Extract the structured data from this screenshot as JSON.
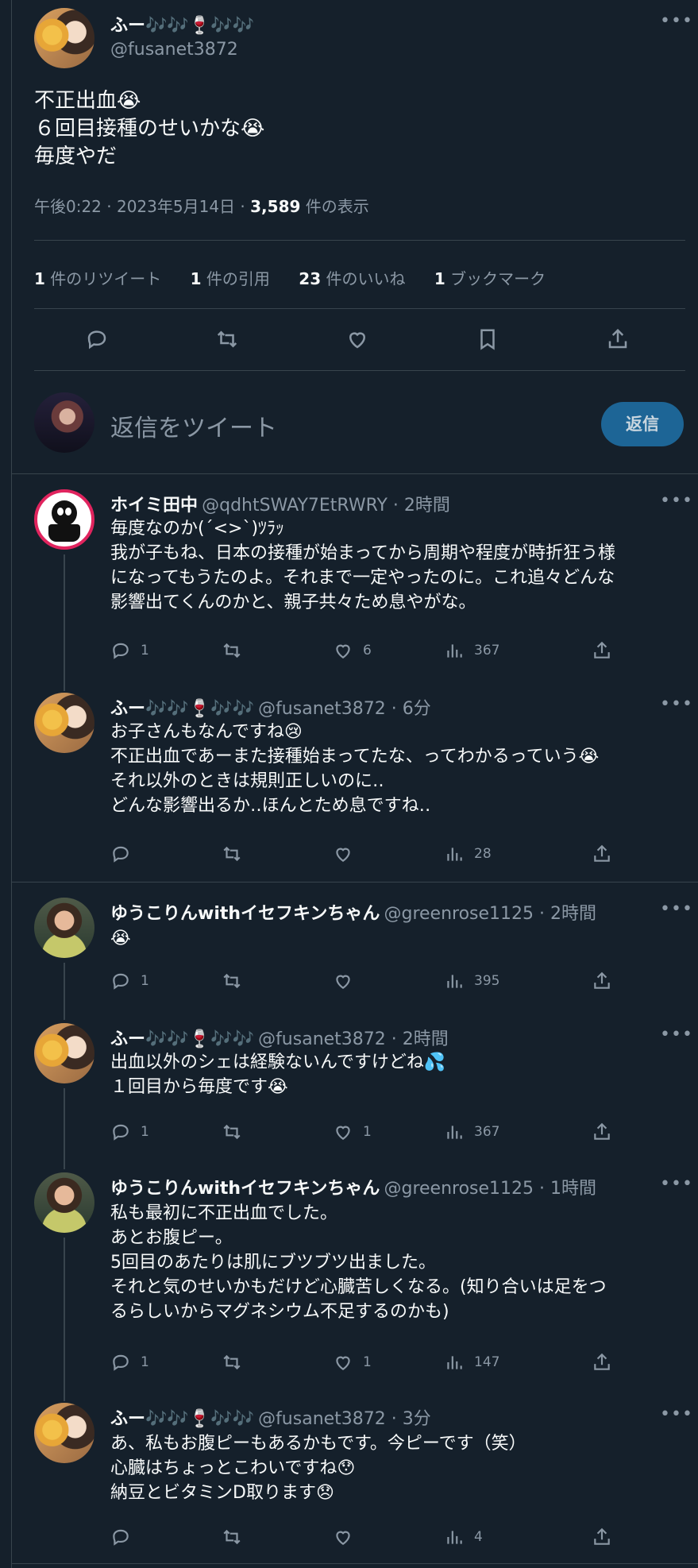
{
  "main_tweet": {
    "name": "ふー🎶🎶🍷🎶🎶",
    "handle": "@fusanet3872",
    "text": "不正出血😭\n６回目接種のせいかな😭\n毎度やだ",
    "timestamp": "午後0:22 · 2023年5月14日 · ",
    "views_count": "3,589",
    "views_label": " 件の表示",
    "stats": [
      {
        "count": "1",
        "label": " 件のリツイート"
      },
      {
        "count": "1",
        "label": " 件の引用"
      },
      {
        "count": "23",
        "label": " 件のいいね"
      },
      {
        "count": "1",
        "label": " ブックマーク"
      }
    ]
  },
  "reply_box": {
    "placeholder": "返信をツイート",
    "button": "返信"
  },
  "replies": [
    {
      "name": "ホイミ田中",
      "handle": "@qdhtSWAY7EtRWRY · 2時間",
      "text": "毎度なのか(´<>`)ﾂﾗｯ\n我が子もね、日本の接種が始まってから周期や程度が時折狂う様\nになってもうたのよ。それまで一定やったのに。これ追々どんな\n影響出てくんのかと、親子共々ため息やがな。",
      "reply": "1",
      "retweet": "",
      "like": "6",
      "views": "367"
    },
    {
      "name": "ふー🎶🎶🍷🎶🎶",
      "handle": "@fusanet3872 · 6分",
      "text": "お子さんもなんですね😢\n不正出血であーまた接種始まってたな、ってわかるっていう😭\nそれ以外のときは規則正しいのに‥\nどんな影響出るか‥ほんとため息ですね‥",
      "reply": "",
      "retweet": "",
      "like": "",
      "views": "28"
    },
    {
      "name": "ゆうこりんwithイセフキンちゃん",
      "handle": "@greenrose1125 · 2時間",
      "text": "😭",
      "reply": "1",
      "retweet": "",
      "like": "",
      "views": "395"
    },
    {
      "name": "ふー🎶🎶🍷🎶🎶",
      "handle": "@fusanet3872 · 2時間",
      "text": "出血以外のシェは経験ないんですけどね💦\n１回目から毎度です😭",
      "reply": "1",
      "retweet": "",
      "like": "1",
      "views": "367"
    },
    {
      "name": "ゆうこりんwithイセフキンちゃん",
      "handle": "@greenrose1125 · 1時間",
      "text": "私も最初に不正出血でした。\nあとお腹ピー。\n5回目のあたりは肌にブツブツ出ました。\nそれと気のせいかもだけど心臓苦しくなる。(知り合いは足をつ\nるらしいからマグネシウム不足するのかも)",
      "reply": "1",
      "retweet": "",
      "like": "1",
      "views": "147"
    },
    {
      "name": "ふー🎶🎶🍷🎶🎶",
      "handle": "@fusanet3872 · 3分",
      "text": "あ、私もお腹ピーもあるかもです。今ピーです（笑）\n心臓はちょっとこわいですね😯\n納豆とビタミンD取ります😞",
      "reply": "",
      "retweet": "",
      "like": "",
      "views": "4"
    }
  ]
}
